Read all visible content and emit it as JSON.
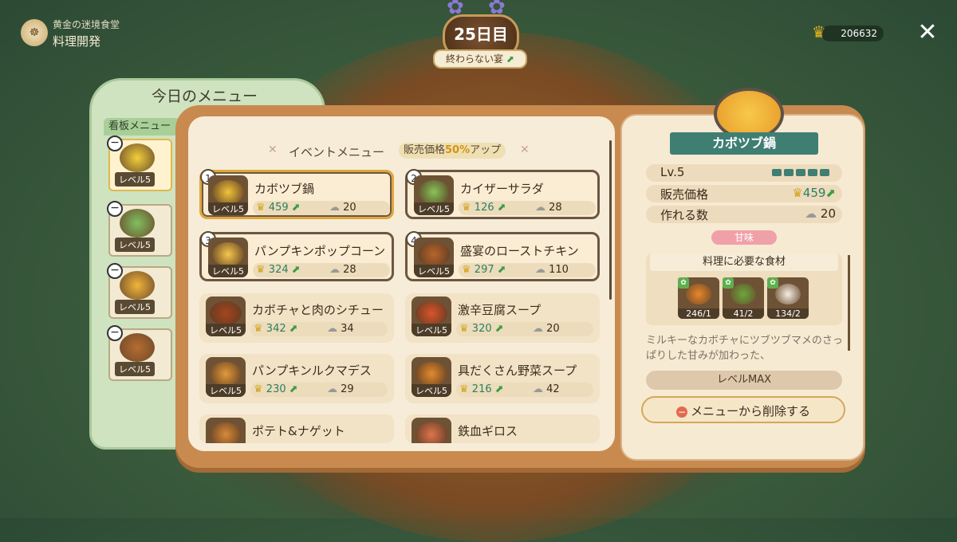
{
  "header": {
    "brand_sub": "黄金の迷境食堂",
    "brand_main": "料理開発",
    "day": "25日目",
    "day_tag": "終わらない宴",
    "coins": "206632"
  },
  "today_panel": {
    "title": "今日のメニュー",
    "signature_tab": "看板メニュー",
    "slots": [
      {
        "level": "レベル5",
        "color": "#f0cf3c"
      },
      {
        "level": "レベル5",
        "color": "#7fc060"
      },
      {
        "level": "レベル5",
        "color": "#f2b43b"
      },
      {
        "level": "レベル5",
        "color": "#b66b30"
      }
    ]
  },
  "event": {
    "title": "イベントメニュー",
    "badge_prefix": "販売価格",
    "badge_pct": "50%",
    "badge_suffix": "アップ"
  },
  "menu": [
    {
      "num": "1",
      "name": "カボツブ鍋",
      "level": "レベル5",
      "price": "459",
      "count": "20",
      "color": "#f2c33b"
    },
    {
      "num": "2",
      "name": "カイザーサラダ",
      "level": "レベル5",
      "price": "126",
      "count": "28",
      "color": "#88c35a"
    },
    {
      "num": "3",
      "name": "パンプキンポップコーン",
      "level": "レベル5",
      "price": "324",
      "count": "28",
      "color": "#f6c64d"
    },
    {
      "num": "4",
      "name": "盛宴のローストチキン",
      "level": "レベル5",
      "price": "297",
      "count": "110",
      "color": "#b6652c"
    },
    {
      "num": "",
      "name": "カボチャと肉のシチュー",
      "level": "レベル5",
      "price": "342",
      "count": "34",
      "color": "#a5451f"
    },
    {
      "num": "",
      "name": "激辛豆腐スープ",
      "level": "レベル5",
      "price": "320",
      "count": "20",
      "color": "#d9542a"
    },
    {
      "num": "",
      "name": "パンプキンルクマデス",
      "level": "レベル5",
      "price": "230",
      "count": "29",
      "color": "#e39a3b"
    },
    {
      "num": "",
      "name": "具だくさん野菜スープ",
      "level": "レベル5",
      "price": "216",
      "count": "42",
      "color": "#e28a2e"
    },
    {
      "num": "",
      "name": "ポテト&ナゲット",
      "level": "",
      "price": "",
      "count": "",
      "color": "#d78a3a"
    },
    {
      "num": "",
      "name": "鉄血ギロス",
      "level": "",
      "price": "",
      "count": "",
      "color": "#e0744c"
    }
  ],
  "detail": {
    "title": "カボツブ鍋",
    "level_label": "Lv.5",
    "price_label": "販売価格",
    "price_value": "459",
    "count_label": "作れる数",
    "count_value": "20",
    "flavor": "甘味",
    "ingredients_title": "料理に必要な食材",
    "ingredients": [
      {
        "name": "pumpkin",
        "count": "246/1",
        "color": "#e8862a"
      },
      {
        "name": "green-beans",
        "count": "41/2",
        "color": "#6aa83d"
      },
      {
        "name": "cream",
        "count": "134/2",
        "color": "#f4efe6"
      }
    ],
    "description": "ミルキーなカボチャにツブツブマメのさっぱりした甘みが加わった、",
    "max_label": "レベルMAX",
    "remove_label": "メニューから削除する"
  }
}
